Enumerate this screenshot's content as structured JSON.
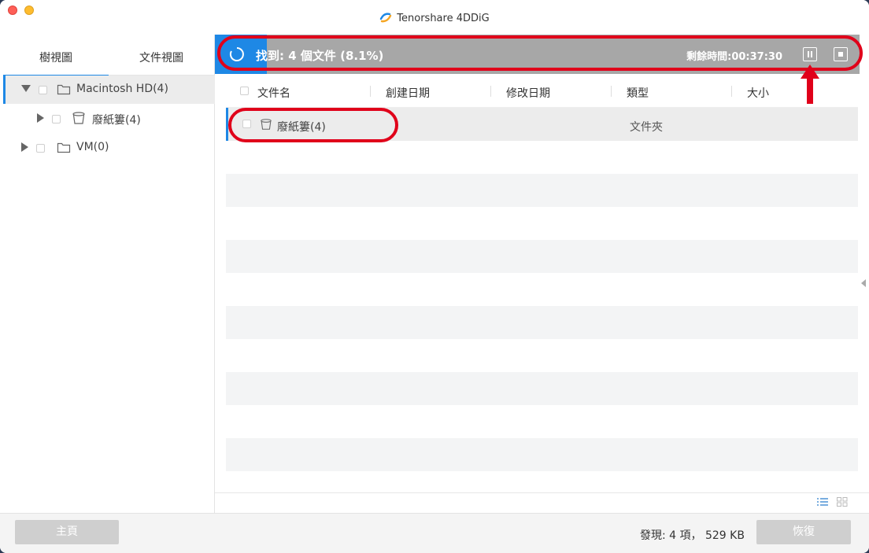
{
  "window": {
    "title": "Tenorshare 4DDiG"
  },
  "sidebar": {
    "tabs": [
      {
        "label": "樹視圖",
        "active": true
      },
      {
        "label": "文件視圖",
        "active": false
      }
    ],
    "tree": [
      {
        "label": "Macintosh HD(4)",
        "expanded": true,
        "selected": true,
        "icon": "folder-icon"
      },
      {
        "label": "廢紙簍(4)",
        "expanded": false,
        "selected": false,
        "icon": "trash-icon"
      },
      {
        "label": "VM(0)",
        "expanded": false,
        "selected": false,
        "icon": "folder-icon"
      }
    ]
  },
  "scan": {
    "found_text": "找到: 4 個文件 (8.1%)",
    "progress": 0.081,
    "remaining_text": "剩餘時間:00:37:30",
    "accent_color": "#1e88e5"
  },
  "table": {
    "columns": [
      "文件名",
      "創建日期",
      "修改日期",
      "類型",
      "大小"
    ],
    "rows": [
      {
        "name": "廢紙簍(4)",
        "created": "",
        "modified": "",
        "type": "文件夾",
        "size": "",
        "icon": "trash-icon"
      }
    ]
  },
  "footer": {
    "home_label": "主頁",
    "summary": "發現: 4 項， 529 KB",
    "recover_label": "恢復"
  },
  "annotation_color": "#e0001a"
}
